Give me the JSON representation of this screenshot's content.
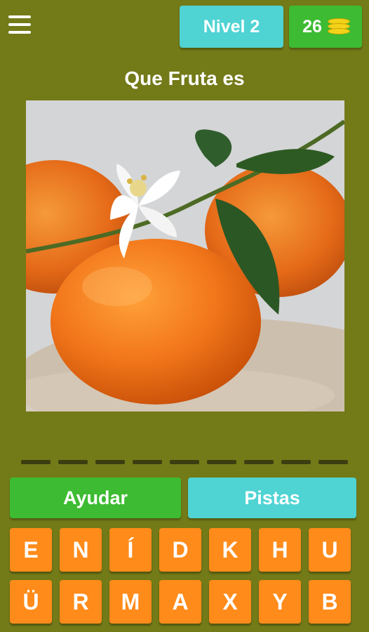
{
  "header": {
    "level_label": "Nivel 2",
    "coins": "26",
    "coin_icon": "coin-stack-icon",
    "menu_icon": "hamburger-menu-icon"
  },
  "question": {
    "title": "Que Fruta es"
  },
  "answer": {
    "slot_count": 9
  },
  "actions": {
    "help_label": "Ayudar",
    "hints_label": "Pistas"
  },
  "keyboard": {
    "row1": [
      "E",
      "N",
      "Í",
      "D",
      "K",
      "H",
      "U"
    ],
    "row2": [
      "Ü",
      "R",
      "M",
      "A",
      "X",
      "Y",
      "B"
    ]
  },
  "colors": {
    "background": "#737a18",
    "level_badge": "#4fd3d3",
    "coin_badge": "#3dbb32",
    "help_button": "#3dbb32",
    "hints_button": "#4fd3d3",
    "key": "#ff8b1a"
  }
}
